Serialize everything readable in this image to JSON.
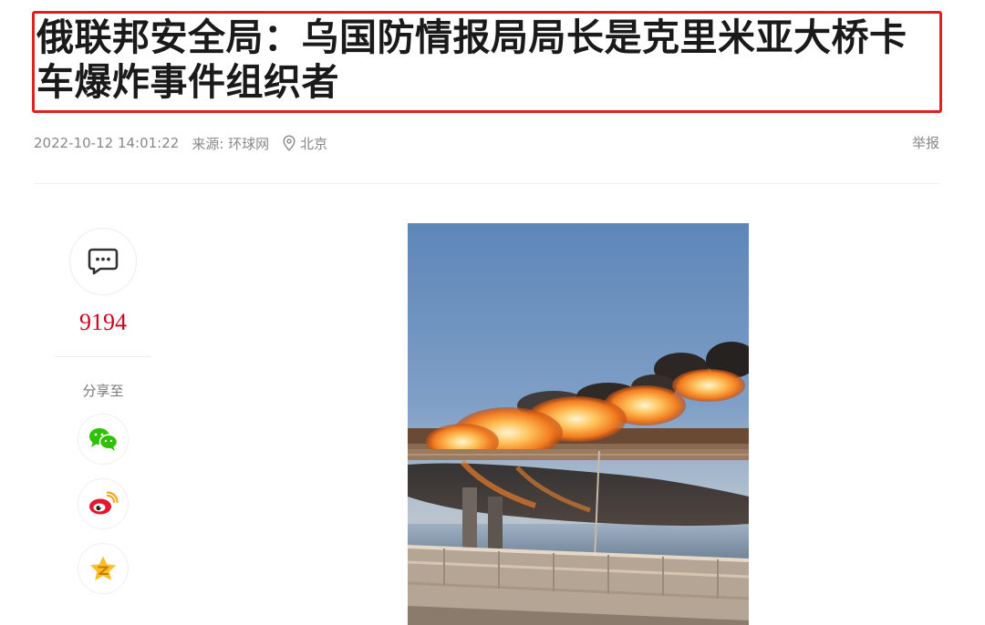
{
  "article": {
    "title": "俄联邦安全局：乌国防情报局局长是克里米亚大桥卡车爆炸事件组织者",
    "datetime": "2022-10-12 14:01:22",
    "source": "来源: 环球网",
    "location": "北京",
    "report_label": "举报"
  },
  "sidebar": {
    "comment_count": "9194",
    "share_label": "分享至",
    "share_targets": [
      "wechat-icon",
      "weibo-icon",
      "qzone-icon"
    ]
  },
  "colors": {
    "highlight_border": "#e02020",
    "count_red": "#d0021b",
    "meta_gray": "#888888"
  },
  "image": {
    "subject": "burning train on bridge"
  }
}
